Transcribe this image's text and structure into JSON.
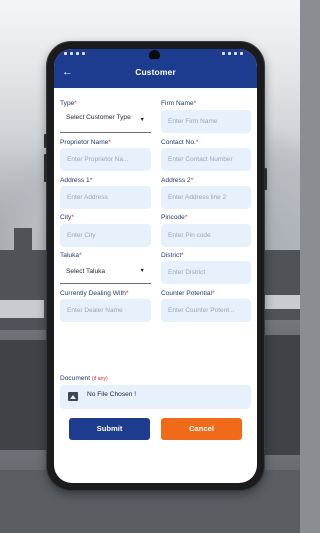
{
  "appbar": {
    "back_icon": "arrow-left-icon",
    "title": "Customer"
  },
  "form": {
    "type": {
      "label": "Type",
      "value": "Select Customer Type"
    },
    "firm_name": {
      "label": "Firm Name",
      "placeholder": "Enter Firm Name"
    },
    "proprietor_name": {
      "label": "Proprietor Name",
      "placeholder": "Enter Proprietor Na..."
    },
    "contact_no": {
      "label": "Contact No.",
      "placeholder": "Enter Contact Number"
    },
    "address1": {
      "label": "Address 1",
      "placeholder": "Enter Address"
    },
    "address2": {
      "label": "Address 2",
      "placeholder": "Enter Address line 2"
    },
    "city": {
      "label": "City",
      "placeholder": "Enter City"
    },
    "pincode": {
      "label": "Pincode",
      "placeholder": "Enter Pin code"
    },
    "taluka": {
      "label": "Taluka",
      "value": "Select Taluka"
    },
    "district": {
      "label": "District",
      "placeholder": "Enter District"
    },
    "dealing_with": {
      "label": "Currently Dealing With",
      "placeholder": "Enter Dealer Name"
    },
    "counter_potential": {
      "label": "Counter Potential",
      "placeholder": "Enter Counter Potent..."
    },
    "document": {
      "label": "Document",
      "note": "(if any)",
      "file_text": "No File Chosen !"
    },
    "required_mark": "*"
  },
  "actions": {
    "submit": "Submit",
    "cancel": "Cancel"
  },
  "colors": {
    "primary": "#1d3c8f",
    "accent": "#ef6b1a",
    "field_bg": "#e6f1fb",
    "required": "#d8262e"
  }
}
